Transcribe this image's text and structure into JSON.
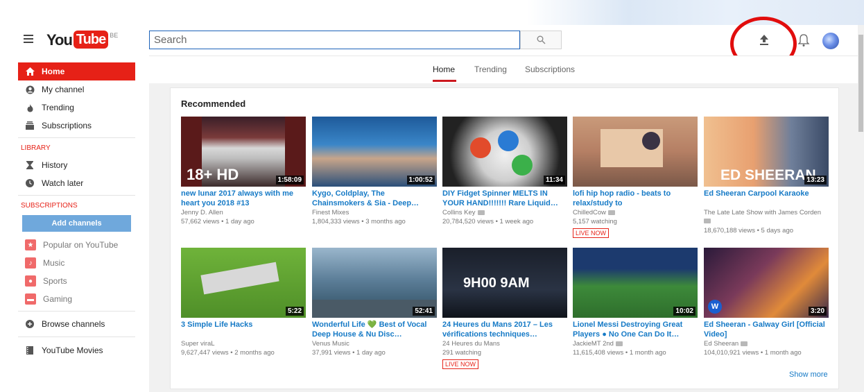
{
  "header": {
    "logo_you": "You",
    "logo_tube": "Tube",
    "country_code": "BE",
    "search_placeholder": "Search"
  },
  "tabs": [
    {
      "label": "Home",
      "active": true
    },
    {
      "label": "Trending",
      "active": false
    },
    {
      "label": "Subscriptions",
      "active": false
    }
  ],
  "guide": {
    "main_items": [
      {
        "label": "Home",
        "icon": "home-icon",
        "active": true
      },
      {
        "label": "My channel",
        "icon": "account-icon"
      },
      {
        "label": "Trending",
        "icon": "flame-icon"
      },
      {
        "label": "Subscriptions",
        "icon": "subscriptions-icon"
      }
    ],
    "library_heading": "LIBRARY",
    "library_items": [
      {
        "label": "History",
        "icon": "hourglass-icon"
      },
      {
        "label": "Watch later",
        "icon": "clock-icon"
      }
    ],
    "subscriptions_heading": "SUBSCRIPTIONS",
    "add_channels_label": "Add channels",
    "subscription_items": [
      {
        "label": "Popular on YouTube",
        "icon": "star-icon",
        "color": "#f06a6a"
      },
      {
        "label": "Music",
        "icon": "music-note-icon",
        "color": "#f06a6a"
      },
      {
        "label": "Sports",
        "icon": "ball-icon",
        "color": "#f06a6a"
      },
      {
        "label": "Gaming",
        "icon": "gamepad-icon",
        "color": "#f06a6a"
      }
    ],
    "browse_channels": "Browse channels",
    "youtube_movies": "YouTube Movies"
  },
  "recommended": {
    "title": "Recommended",
    "show_more": "Show more",
    "videos": [
      {
        "title": "new lunar 2017 always with me heart you 2018 #13",
        "channel": "Jenny D. Allen",
        "verified": false,
        "meta": "57,662 views • 1 day ago",
        "duration": "1:58:09",
        "thumb_text": "18+ HD",
        "live": false
      },
      {
        "title": "Kygo, Coldplay, The Chainsmokers & Sia - Deep…",
        "channel": "Finest Mixes",
        "verified": false,
        "meta": "1,804,333 views • 3 months ago",
        "duration": "1:00:52",
        "thumb_text": "",
        "live": false
      },
      {
        "title": "DIY Fidget Spinner MELTS IN YOUR HAND!!!!!!! Rare Liquid…",
        "channel": "Collins Key",
        "verified": true,
        "meta": "20,784,520 views • 1 week ago",
        "duration": "11:34",
        "thumb_text": "",
        "live": false
      },
      {
        "title": "lofi hip hop radio - beats to relax/study to",
        "channel": "ChilledCow",
        "verified": true,
        "meta": "5,157 watching",
        "duration": "",
        "thumb_text": "",
        "live": true,
        "live_label": "LIVE NOW"
      },
      {
        "title": "Ed Sheeran Carpool Karaoke",
        "channel": "The Late Late Show with James Corden",
        "verified": true,
        "meta": "18,670,188 views • 5 days ago",
        "duration": "13:23",
        "thumb_text": "ED SHEERAN",
        "live": false
      },
      {
        "title": "3 Simple Life Hacks",
        "channel": "Super viraL",
        "verified": false,
        "meta": "9,627,447 views • 2 months ago",
        "duration": "5:22",
        "thumb_text": "",
        "live": false
      },
      {
        "title": "Wonderful Life 💚 Best of Vocal Deep House & Nu Disc…",
        "channel": "Venus Music",
        "verified": false,
        "meta": "37,991 views • 1 day ago",
        "duration": "52:41",
        "thumb_text": "",
        "live": false
      },
      {
        "title": "24 Heures du Mans 2017 – Les vérifications techniques…",
        "channel": "24 Heures du Mans",
        "verified": false,
        "meta": "291 watching",
        "duration": "",
        "thumb_text": "9H00  9AM",
        "live": true,
        "live_label": "LIVE NOW"
      },
      {
        "title": "Lionel Messi Destroying Great Players ● No One Can Do It…",
        "channel": "JackieMT 2nd",
        "verified": true,
        "meta": "11,615,408 views • 1 month ago",
        "duration": "10:02",
        "thumb_text": "",
        "live": false
      },
      {
        "title": "Ed Sheeran - Galway Girl [Official Video]",
        "channel": "Ed Sheeran",
        "verified": true,
        "meta": "104,010,921 views • 1 month ago",
        "duration": "3:20",
        "thumb_text": "",
        "live": false
      }
    ]
  },
  "colors": {
    "brand_red": "#e62117",
    "link_blue": "#167ac6",
    "annotation_red": "#e10d0d"
  }
}
